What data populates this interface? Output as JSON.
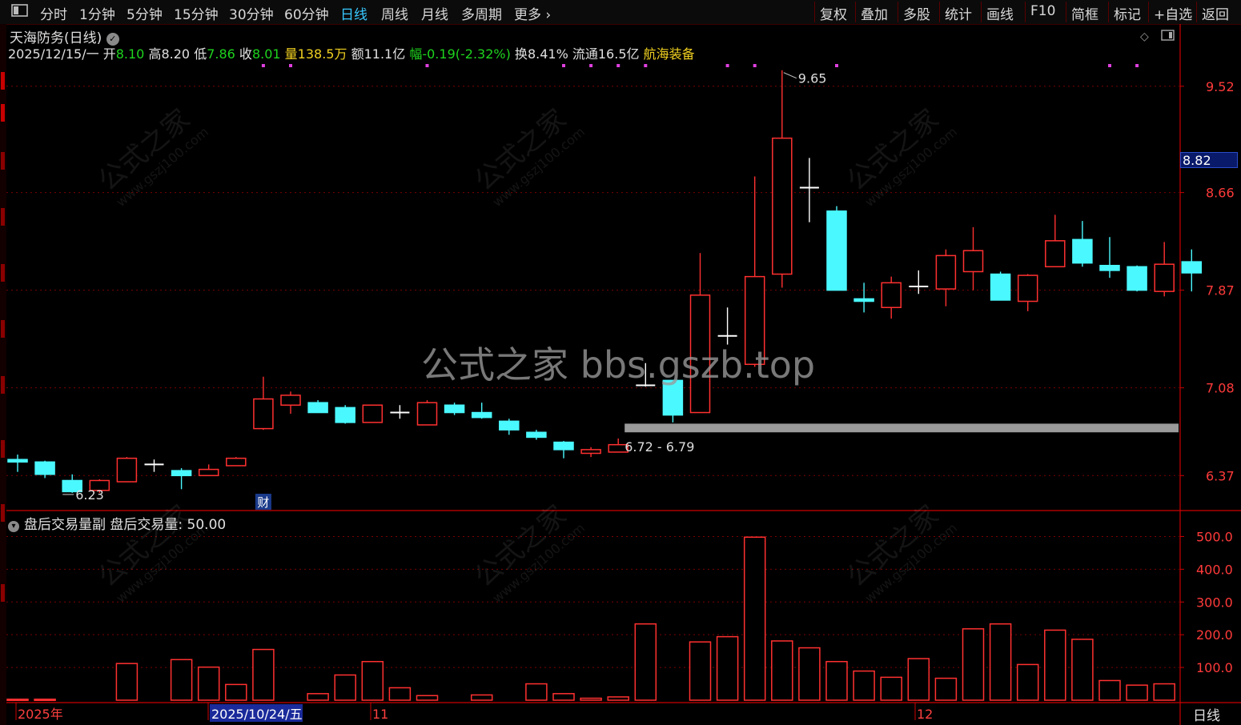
{
  "toolbar": {
    "left_items": [
      {
        "label": "分时",
        "active": false
      },
      {
        "label": "1分钟",
        "active": false
      },
      {
        "label": "5分钟",
        "active": false
      },
      {
        "label": "15分钟",
        "active": false
      },
      {
        "label": "30分钟",
        "active": false
      },
      {
        "label": "60分钟",
        "active": false
      },
      {
        "label": "日线",
        "active": true
      },
      {
        "label": "周线",
        "active": false
      },
      {
        "label": "月线",
        "active": false
      },
      {
        "label": "多周期",
        "active": false
      },
      {
        "label": "更多",
        "active": false
      }
    ],
    "right_items": [
      "复权",
      "叠加",
      "多股",
      "统计",
      "画线",
      "F10",
      "简框",
      "标记",
      "+自选",
      "返回"
    ]
  },
  "stock": {
    "title": "天海防务(日线)",
    "date": "2025/12/15/一",
    "open_label": "开",
    "open": "8.10",
    "high_label": "高",
    "high": "8.20",
    "low_label": "低",
    "low": "7.86",
    "close_label": "收",
    "close": "8.01",
    "volume_label": "量",
    "volume": "138.5万",
    "amount_label": "额",
    "amount": "11.1亿",
    "change_label": "幅",
    "change": "-0.19(-2.32%)",
    "turnover_label": "换",
    "turnover": "8.41%",
    "float_label": "流通",
    "float": "16.5亿",
    "sector": "航海装备"
  },
  "watermark": "公式之家 bbs.gszb.top",
  "diag_watermark": {
    "cn": "公式之家",
    "url": "www.gszj100.com"
  },
  "current_price": "8.82",
  "sub_indicator": {
    "name": "盘后交易量副",
    "series": "盘后交易量",
    "value": "50.00"
  },
  "period_label": "日线",
  "colors": {
    "up": "#ff3030",
    "down": "#4af8ff",
    "grid": "#7a0000",
    "axis": "#cc0000",
    "active_tab": "#38c8ff",
    "support": "#9a9a9a"
  },
  "chart_data": [
    {
      "type": "candlestick",
      "title": "天海防务(日线)",
      "ylim": [
        6.1,
        9.7
      ],
      "y_ticks": [
        "9.52",
        "8.66",
        "7.87",
        "7.08",
        "6.37"
      ],
      "x_labels": [
        "2025年",
        "2025/10/24/五",
        "11",
        "12"
      ],
      "annotations": [
        {
          "text": "6.23",
          "index": 2,
          "price": 6.23
        },
        {
          "text": "9.65",
          "index": 28,
          "price": 9.65
        },
        {
          "text": "6.72 - 6.79",
          "index": 22,
          "price": 6.76
        },
        {
          "text": "财",
          "index": 9
        }
      ],
      "support_band": [
        6.72,
        6.79
      ],
      "candles": [
        {
          "o": 6.5,
          "h": 6.54,
          "l": 6.4,
          "c": 6.48
        },
        {
          "o": 6.48,
          "h": 6.49,
          "l": 6.35,
          "c": 6.38
        },
        {
          "o": 6.33,
          "h": 6.38,
          "l": 6.23,
          "c": 6.24
        },
        {
          "o": 6.25,
          "h": 6.34,
          "l": 6.23,
          "c": 6.33
        },
        {
          "o": 6.32,
          "h": 6.52,
          "l": 6.32,
          "c": 6.51
        },
        {
          "o": 6.46,
          "h": 6.5,
          "l": 6.4,
          "c": 6.46
        },
        {
          "o": 6.41,
          "h": 6.43,
          "l": 6.26,
          "c": 6.37
        },
        {
          "o": 6.37,
          "h": 6.46,
          "l": 6.37,
          "c": 6.42
        },
        {
          "o": 6.45,
          "h": 6.52,
          "l": 6.45,
          "c": 6.51
        },
        {
          "o": 6.75,
          "h": 7.17,
          "l": 6.74,
          "c": 6.99
        },
        {
          "o": 6.94,
          "h": 7.05,
          "l": 6.87,
          "c": 7.02
        },
        {
          "o": 6.96,
          "h": 6.98,
          "l": 6.88,
          "c": 6.88
        },
        {
          "o": 6.92,
          "h": 6.94,
          "l": 6.79,
          "c": 6.8
        },
        {
          "o": 6.8,
          "h": 6.94,
          "l": 6.8,
          "c": 6.94
        },
        {
          "o": 6.88,
          "h": 6.94,
          "l": 6.83,
          "c": 6.88
        },
        {
          "o": 6.78,
          "h": 6.98,
          "l": 6.78,
          "c": 6.96
        },
        {
          "o": 6.94,
          "h": 6.96,
          "l": 6.86,
          "c": 6.88
        },
        {
          "o": 6.88,
          "h": 6.96,
          "l": 6.83,
          "c": 6.84
        },
        {
          "o": 6.81,
          "h": 6.83,
          "l": 6.7,
          "c": 6.74
        },
        {
          "o": 6.72,
          "h": 6.74,
          "l": 6.66,
          "c": 6.68
        },
        {
          "o": 6.64,
          "h": 6.65,
          "l": 6.51,
          "c": 6.58
        },
        {
          "o": 6.55,
          "h": 6.6,
          "l": 6.52,
          "c": 6.58
        },
        {
          "o": 6.56,
          "h": 6.67,
          "l": 6.56,
          "c": 6.62
        },
        {
          "o": 7.09,
          "h": 7.28,
          "l": 7.09,
          "c": 7.1
        },
        {
          "o": 7.14,
          "h": 7.14,
          "l": 6.8,
          "c": 6.86
        },
        {
          "o": 6.88,
          "h": 8.17,
          "l": 6.88,
          "c": 7.83
        },
        {
          "o": 7.5,
          "h": 7.73,
          "l": 7.43,
          "c": 7.49
        },
        {
          "o": 7.27,
          "h": 8.79,
          "l": 7.25,
          "c": 7.98
        },
        {
          "o": 8.0,
          "h": 9.65,
          "l": 7.89,
          "c": 9.1
        },
        {
          "o": 8.7,
          "h": 8.94,
          "l": 8.42,
          "c": 8.69
        },
        {
          "o": 8.51,
          "h": 8.55,
          "l": 7.87,
          "c": 7.87
        },
        {
          "o": 7.8,
          "h": 7.93,
          "l": 7.69,
          "c": 7.78
        },
        {
          "o": 7.73,
          "h": 7.98,
          "l": 7.64,
          "c": 7.93
        },
        {
          "o": 7.9,
          "h": 8.03,
          "l": 7.84,
          "c": 7.9
        },
        {
          "o": 7.88,
          "h": 8.2,
          "l": 7.74,
          "c": 8.15
        },
        {
          "o": 8.02,
          "h": 8.38,
          "l": 7.87,
          "c": 8.19
        },
        {
          "o": 8.0,
          "h": 8.02,
          "l": 7.79,
          "c": 7.79
        },
        {
          "o": 7.78,
          "h": 8.0,
          "l": 7.7,
          "c": 7.99
        },
        {
          "o": 8.06,
          "h": 8.48,
          "l": 8.06,
          "c": 8.27
        },
        {
          "o": 8.28,
          "h": 8.43,
          "l": 8.06,
          "c": 8.09
        },
        {
          "o": 8.07,
          "h": 8.3,
          "l": 7.97,
          "c": 8.03
        },
        {
          "o": 8.06,
          "h": 8.07,
          "l": 7.86,
          "c": 7.87
        },
        {
          "o": 7.86,
          "h": 8.26,
          "l": 7.82,
          "c": 8.08
        },
        {
          "o": 8.1,
          "h": 8.2,
          "l": 7.86,
          "c": 8.01
        }
      ],
      "marker_indices": [
        9,
        10,
        15,
        20,
        21,
        22,
        23,
        26,
        27,
        30,
        40,
        41
      ]
    },
    {
      "type": "bar",
      "title": "盘后交易量副",
      "ylim": [
        0,
        550
      ],
      "y_ticks": [
        "500.0",
        "400.0",
        "300.0",
        "200.0",
        "100.0"
      ],
      "series": [
        {
          "name": "盘后交易量",
          "values": [
            3,
            3,
            0,
            0,
            112,
            0,
            124,
            101,
            48,
            155,
            0,
            20,
            77,
            118,
            38,
            14,
            0,
            16,
            0,
            50,
            20,
            6,
            10,
            233,
            0,
            178,
            194,
            498,
            181,
            160,
            118,
            89,
            70,
            127,
            67,
            218,
            233,
            109,
            214,
            186,
            60,
            46,
            50
          ]
        }
      ]
    }
  ]
}
